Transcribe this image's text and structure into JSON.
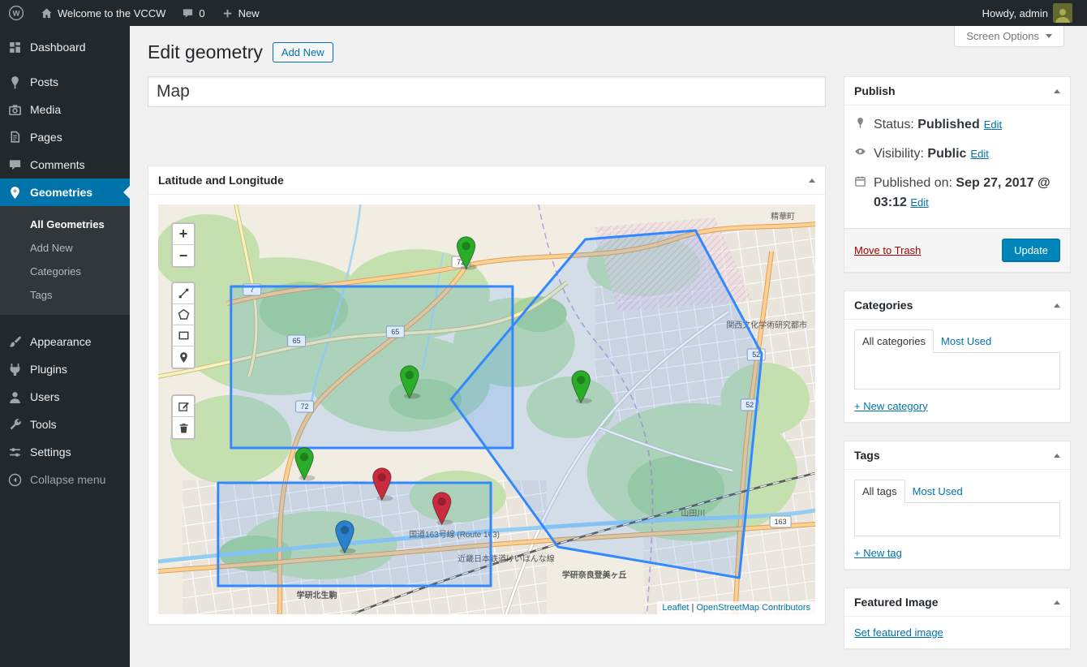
{
  "admin_bar": {
    "site_name": "Welcome to the VCCW",
    "comments_count": "0",
    "new_label": "New",
    "howdy_text": "Howdy, admin"
  },
  "screen_options": {
    "label": "Screen Options"
  },
  "header": {
    "title": "Edit geometry",
    "add_new_label": "Add New"
  },
  "sidebar": {
    "items": [
      {
        "label": "Dashboard"
      },
      {
        "label": "Posts"
      },
      {
        "label": "Media"
      },
      {
        "label": "Pages"
      },
      {
        "label": "Comments"
      },
      {
        "label": "Geometries"
      },
      {
        "label": "Appearance"
      },
      {
        "label": "Plugins"
      },
      {
        "label": "Users"
      },
      {
        "label": "Tools"
      },
      {
        "label": "Settings"
      },
      {
        "label": "Collapse menu"
      }
    ],
    "geometries_submenu": [
      {
        "label": "All Geometries"
      },
      {
        "label": "Add New"
      },
      {
        "label": "Categories"
      },
      {
        "label": "Tags"
      }
    ]
  },
  "editor": {
    "title_value": "Map"
  },
  "map_box": {
    "title": "Latitude and Longitude",
    "zoom_in": "+",
    "zoom_out": "−",
    "attribution": {
      "leaflet": "Leaflet",
      "separator": "|",
      "osm": "OpenStreetMap Contributors"
    },
    "labels": {
      "town": "精華町",
      "station_left": "学研北生駒",
      "station_right": "学研奈良登美ヶ丘",
      "route163": "国道163号線 (Route 163)",
      "river": "山田川",
      "railway": "近畿日本鉄道けいはんな線",
      "district": "関西文化学術研究都市",
      "shield_7": "7",
      "shield_65": "65",
      "shield_72": "72",
      "shield_52": "52",
      "shield_163": "163"
    },
    "colors": {
      "overlay_blue": "#3388ff",
      "marker_green": "#2AAD27",
      "marker_red": "#CB2B3E",
      "marker_blue": "#2A81CB"
    }
  },
  "publish_box": {
    "title": "Publish",
    "status_label": "Status:",
    "status_value": "Published",
    "visibility_label": "Visibility:",
    "visibility_value": "Public",
    "published_label": "Published on:",
    "published_value": "Sep 27, 2017 @ 03:12",
    "edit_label": "Edit",
    "move_to_trash_label": "Move to Trash",
    "update_label": "Update"
  },
  "categories_box": {
    "title": "Categories",
    "tab_all": "All categories",
    "tab_most_used": "Most Used",
    "add_new_label": "+ New category"
  },
  "tags_box": {
    "title": "Tags",
    "tab_all": "All tags",
    "tab_most_used": "Most Used",
    "add_new_label": "+ New tag"
  },
  "featured_box": {
    "title": "Featured Image",
    "set_label": "Set featured image"
  }
}
